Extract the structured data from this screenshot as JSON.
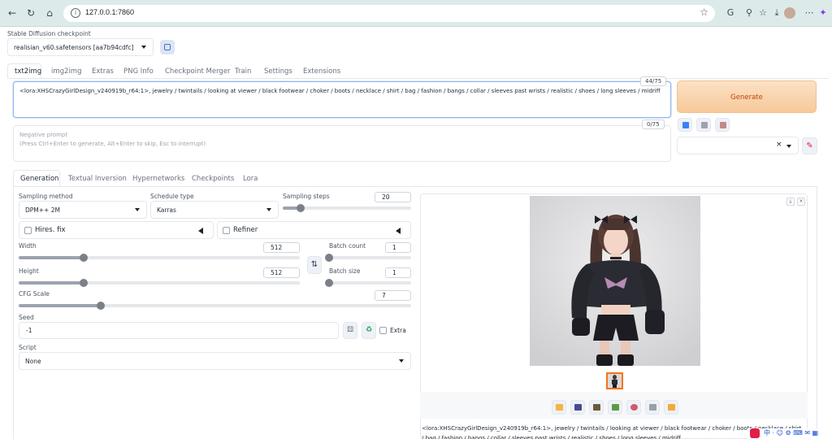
{
  "browser": {
    "url": "127.0.0.1:7860"
  },
  "checkpoint": {
    "label": "Stable Diffusion checkpoint",
    "value": "realisian_v60.safetensors [aa7b94cdfc]"
  },
  "tabs": [
    "txt2img",
    "img2img",
    "Extras",
    "PNG Info",
    "Checkpoint Merger",
    "Train",
    "Settings",
    "Extensions"
  ],
  "prompt": {
    "value": "<lora:XHSCrazyGirlDesign_v240919b_r64:1>, jewelry / twintails / looking at viewer / black footwear / choker / boots / necklace / shirt / bag / fashion / bangs / collar / sleeves past wrists / realistic / shoes / long sleeves / midriff",
    "counter": "44/75"
  },
  "negative_prompt": {
    "placeholder": "Negative prompt",
    "hint": "(Press Ctrl+Enter to generate, Alt+Enter to skip, Esc to interrupt)",
    "counter": "0/75"
  },
  "generate_label": "Generate",
  "subtabs": [
    "Generation",
    "Textual Inversion",
    "Hypernetworks",
    "Checkpoints",
    "Lora"
  ],
  "settings": {
    "sampling_method_label": "Sampling method",
    "sampling_method": "DPM++ 2M",
    "schedule_type_label": "Schedule type",
    "schedule_type": "Karras",
    "sampling_steps_label": "Sampling steps",
    "sampling_steps": "20",
    "sampling_steps_fraction": 0.14,
    "hires_label": "Hires. fix",
    "refiner_label": "Refiner",
    "width_label": "Width",
    "width": "512",
    "width_fraction": 0.23,
    "height_label": "Height",
    "height": "512",
    "height_fraction": 0.23,
    "batch_count_label": "Batch count",
    "batch_count": "1",
    "batch_size_label": "Batch size",
    "batch_size": "1",
    "cfg_label": "CFG Scale",
    "cfg": "7",
    "cfg_fraction": 0.21,
    "seed_label": "Seed",
    "seed": "-1",
    "extra_label": "Extra",
    "script_label": "Script",
    "script": "None"
  },
  "output": {
    "text": "<lora:XHSCrazyGirlDesign_v240919b_r64:1>, jewelry / twintails / looking at viewer / black footwear / choker / boots / necklace / shirt / bag / fashion / bangs / collar / sleeves past wrists / realistic / shoes / long sleeves / midriff"
  },
  "icons": {
    "colors": {
      "accent": "#f97316",
      "generate_text": "#c2410c",
      "focus": "#93b4f0"
    }
  }
}
